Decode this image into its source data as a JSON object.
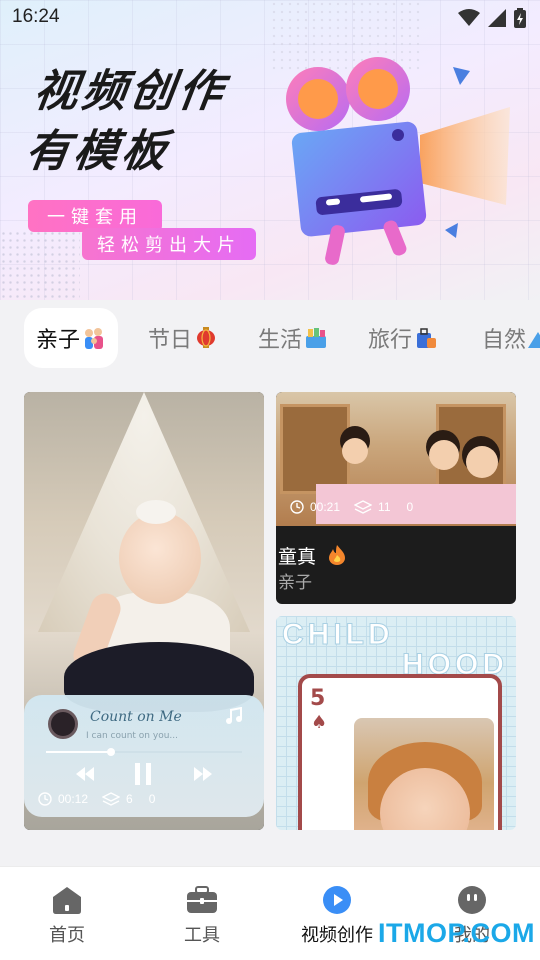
{
  "status_bar": {
    "time": "16:24",
    "icons": [
      "wifi-icon",
      "cell-signal-icon",
      "battery-charging-icon"
    ]
  },
  "hero": {
    "title_line1": "视频创作",
    "title_line2": "有模板",
    "tag1": "一键套用",
    "tag2": "轻松剪出大片",
    "illustration": "movie-camera-icon"
  },
  "tabs": [
    {
      "label": "亲子",
      "icon": "family-emoji",
      "active": true
    },
    {
      "label": "节日",
      "icon": "lantern-emoji",
      "active": false
    },
    {
      "label": "生活",
      "icon": "gift-basket-emoji",
      "active": false
    },
    {
      "label": "旅行",
      "icon": "luggage-emoji",
      "active": false
    },
    {
      "label": "自然",
      "icon": "mountain-emoji",
      "active": false
    }
  ],
  "cards": [
    {
      "player": {
        "song": "Count on Me",
        "lyric": "I can count on you...",
        "progress": 0.33
      },
      "duration": "00:12",
      "layers": "6",
      "count": "0"
    },
    {
      "title": "童真",
      "badge_icon": "fire-emoji",
      "category": "亲子",
      "duration": "00:21",
      "layers": "11",
      "count": "0"
    },
    {
      "overlay_text_line1": "CHILD",
      "overlay_text_line2": "HOOD",
      "card_number": "5",
      "card_suit": "♠"
    }
  ],
  "bottom_nav": [
    {
      "label": "首页",
      "icon": "home-icon",
      "active": false
    },
    {
      "label": "工具",
      "icon": "toolbox-icon",
      "active": false
    },
    {
      "label": "视频创作",
      "icon": "play-circle-icon",
      "active": true
    },
    {
      "label": "我的",
      "icon": "profile-icon",
      "active": false
    }
  ],
  "watermark": "ITMOP.COM",
  "colors": {
    "accent_blue": "#3a8ef6",
    "pink": "#f96ad9",
    "card_dark": "#1c1c1c"
  }
}
